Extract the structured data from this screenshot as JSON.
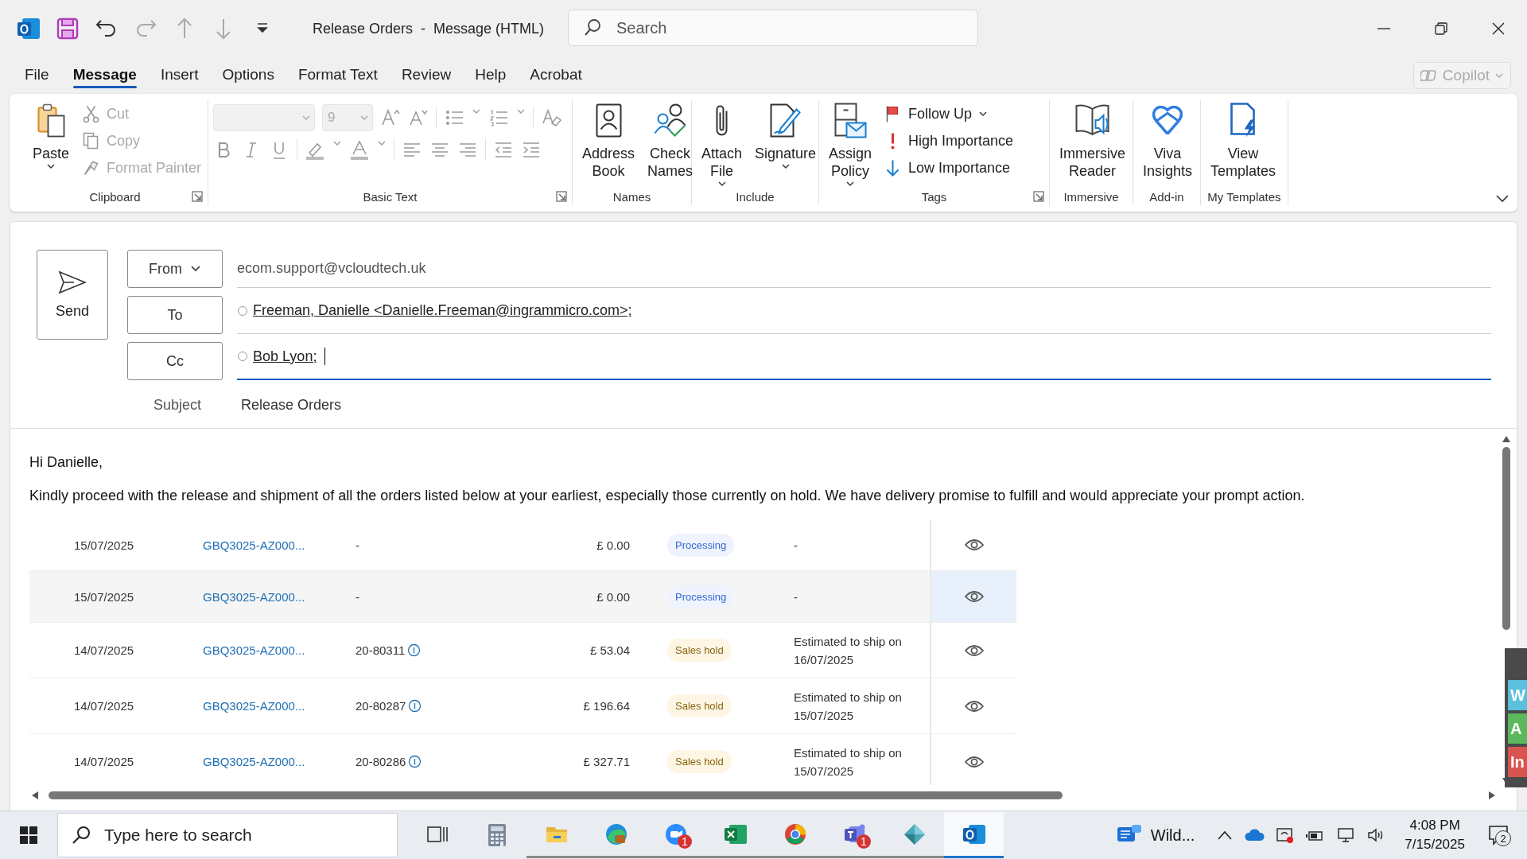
{
  "window": {
    "title": "Release Orders  -  Message (HTML)",
    "search_placeholder": "Search"
  },
  "menu_tabs": [
    {
      "label": "File",
      "selected": false
    },
    {
      "label": "Message",
      "selected": true
    },
    {
      "label": "Insert",
      "selected": false
    },
    {
      "label": "Options",
      "selected": false
    },
    {
      "label": "Format Text",
      "selected": false
    },
    {
      "label": "Review",
      "selected": false
    },
    {
      "label": "Help",
      "selected": false
    },
    {
      "label": "Acrobat",
      "selected": false
    }
  ],
  "copilot": {
    "label": "Copilot",
    "disabled": true
  },
  "ribbon": [
    {
      "label": "Clipboard",
      "launcher": true,
      "items": [
        {
          "kind": "large",
          "lines": [
            "Paste"
          ],
          "dropdown": true,
          "disabled": false
        },
        {
          "kind": "stack",
          "entries": [
            {
              "label": "Cut",
              "disabled": true,
              "dropdown": false
            },
            {
              "label": "Copy",
              "disabled": true,
              "dropdown": false
            },
            {
              "label": "Format Painter",
              "disabled": true,
              "dropdown": false
            }
          ]
        }
      ]
    },
    {
      "label": "Basic Text",
      "launcher": true,
      "items": [
        {
          "kind": "format",
          "font_size": "9"
        }
      ]
    },
    {
      "label": "Names",
      "launcher": false,
      "items": [
        {
          "kind": "large",
          "lines": [
            "Address",
            "Book"
          ],
          "dropdown": false,
          "disabled": false
        },
        {
          "kind": "large",
          "lines": [
            "Check",
            "Names"
          ],
          "dropdown": false,
          "disabled": false
        }
      ]
    },
    {
      "label": "Include",
      "launcher": false,
      "items": [
        {
          "kind": "large",
          "lines": [
            "Attach",
            "File"
          ],
          "dropdown": true,
          "disabled": false
        },
        {
          "kind": "large",
          "lines": [
            "Signature"
          ],
          "dropdown": true,
          "disabled": false
        }
      ]
    },
    {
      "label": "Tags",
      "launcher": true,
      "items": [
        {
          "kind": "large",
          "lines": [
            "Assign",
            "Policy"
          ],
          "dropdown": true,
          "disabled": false
        },
        {
          "kind": "stack",
          "entries": [
            {
              "label": "Follow Up",
              "disabled": false,
              "dropdown": true
            },
            {
              "label": "High Importance",
              "disabled": false,
              "dropdown": false
            },
            {
              "label": "Low Importance",
              "disabled": false,
              "dropdown": false
            }
          ]
        }
      ]
    },
    {
      "label": "Immersive",
      "launcher": false,
      "items": [
        {
          "kind": "large",
          "lines": [
            "Immersive",
            "Reader"
          ],
          "dropdown": false,
          "disabled": false
        }
      ]
    },
    {
      "label": "Add-in",
      "launcher": false,
      "items": [
        {
          "kind": "large",
          "lines": [
            "Viva",
            "Insights"
          ],
          "dropdown": false,
          "disabled": false
        }
      ]
    },
    {
      "label": "My Templates",
      "launcher": false,
      "items": [
        {
          "kind": "large",
          "lines": [
            "View",
            "Templates"
          ],
          "dropdown": false,
          "disabled": false
        }
      ]
    }
  ],
  "compose": {
    "send": "Send",
    "from_button": "From",
    "from_value": "ecom.support@vcloudtech.uk",
    "to_button": "To",
    "to_recipients": [
      "Freeman, Danielle <Danielle.Freeman@ingrammicro.com>;"
    ],
    "cc_button": "Cc",
    "cc_recipients": [
      "Bob Lyon;"
    ],
    "subject_label": "Subject",
    "subject": "Release Orders"
  },
  "body": {
    "greeting": "Hi Danielle,",
    "paragraph": "Kindly proceed with the release and shipment of all the orders listed below at your earliest, especially those currently on hold. We have delivery promise to fulfill and would appreciate your prompt action.",
    "rows": [
      {
        "date": "15/07/2025",
        "order": "GBQ3025-AZ000...",
        "reference": "-",
        "info": false,
        "amount": "£ 0.00",
        "status": {
          "label": "Processing",
          "kind": "processing"
        },
        "eta": "-",
        "highlighted": false
      },
      {
        "date": "15/07/2025",
        "order": "GBQ3025-AZ000...",
        "reference": "-",
        "info": false,
        "amount": "£ 0.00",
        "status": {
          "label": "Processing",
          "kind": "processing"
        },
        "eta": "-",
        "highlighted": true
      },
      {
        "date": "14/07/2025",
        "order": "GBQ3025-AZ000...",
        "reference": "20-80311",
        "info": true,
        "amount": "£ 53.04",
        "status": {
          "label": "Sales hold",
          "kind": "hold"
        },
        "eta": "Estimated to ship on 16/07/2025",
        "highlighted": false
      },
      {
        "date": "14/07/2025",
        "order": "GBQ3025-AZ000...",
        "reference": "20-80287",
        "info": true,
        "amount": "£ 196.64",
        "status": {
          "label": "Sales hold",
          "kind": "hold"
        },
        "eta": "Estimated to ship on 15/07/2025",
        "highlighted": false
      },
      {
        "date": "14/07/2025",
        "order": "GBQ3025-AZ000...",
        "reference": "20-80286",
        "info": true,
        "amount": "£ 327.71",
        "status": {
          "label": "Sales hold",
          "kind": "hold"
        },
        "eta": "Estimated to ship on 15/07/2025",
        "highlighted": false
      }
    ]
  },
  "side_tabs": [
    {
      "label": "W",
      "color": "#5bc0de"
    },
    {
      "label": "A",
      "color": "#5cb85c"
    },
    {
      "label": "In",
      "color": "#d9534f"
    }
  ],
  "taskbar": {
    "search_placeholder": "Type here to search",
    "apps": [
      {
        "running": false,
        "active": false
      },
      {
        "running": false,
        "active": false
      },
      {
        "running": true,
        "active": false
      },
      {
        "running": true,
        "active": false
      },
      {
        "running": true,
        "active": false,
        "badge": "1"
      },
      {
        "running": true,
        "active": false
      },
      {
        "running": true,
        "active": false
      },
      {
        "running": true,
        "active": false,
        "badge": "1"
      },
      {
        "running": true,
        "active": false
      },
      {
        "running": true,
        "active": true
      }
    ],
    "weather": "Wild...",
    "time": "4:08 PM",
    "date": "7/15/2025",
    "notifications": "2"
  }
}
